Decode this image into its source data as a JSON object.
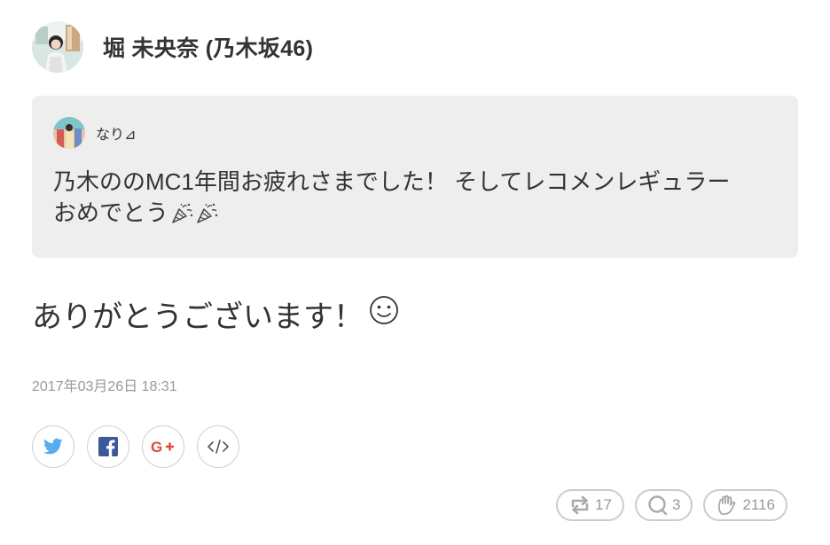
{
  "author": {
    "name": "堀 未央奈 (乃木坂46)",
    "avatar": "profile-photo"
  },
  "quoted_tweet": {
    "user": "なり⊿",
    "avatar": "profile-photo",
    "line1": "乃木ののMC1年間お疲れさまでした！ そしてレコメンレギュラー",
    "line2": "おめでとう",
    "emoji": [
      "party-popper-icon",
      "party-popper-icon"
    ]
  },
  "reply": {
    "text": "ありがとうございます！",
    "emoji": "smiling-face-icon"
  },
  "timestamp": "2017年03月26日 18:31",
  "share_buttons": [
    {
      "name": "twitter",
      "icon": "twitter-bird-icon",
      "color": "#55acee"
    },
    {
      "name": "facebook",
      "icon": "facebook-f-icon",
      "color": "#3b5998"
    },
    {
      "name": "google-plus",
      "icon": "google-plus-icon",
      "color": "#dd4b39"
    },
    {
      "name": "embed",
      "icon": "code-icon",
      "color": "#555555"
    }
  ],
  "reactions": {
    "retweets": "17",
    "replies": "3",
    "likes": "2116"
  }
}
